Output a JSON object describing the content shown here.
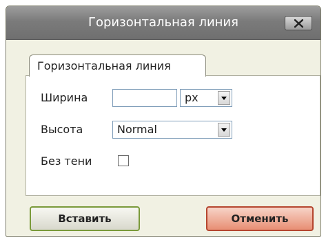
{
  "dialog": {
    "title": "Горизонтальная линия",
    "close_icon": "close-x-icon"
  },
  "tab": {
    "label": "Горизонтальная линия"
  },
  "fields": {
    "width_label": "Ширина",
    "width_value": "",
    "width_unit": "px",
    "height_label": "Высота",
    "height_value": "Normal",
    "noshade_label": "Без тени",
    "noshade_checked": false
  },
  "buttons": {
    "insert": "Вставить",
    "cancel": "Отменить"
  }
}
